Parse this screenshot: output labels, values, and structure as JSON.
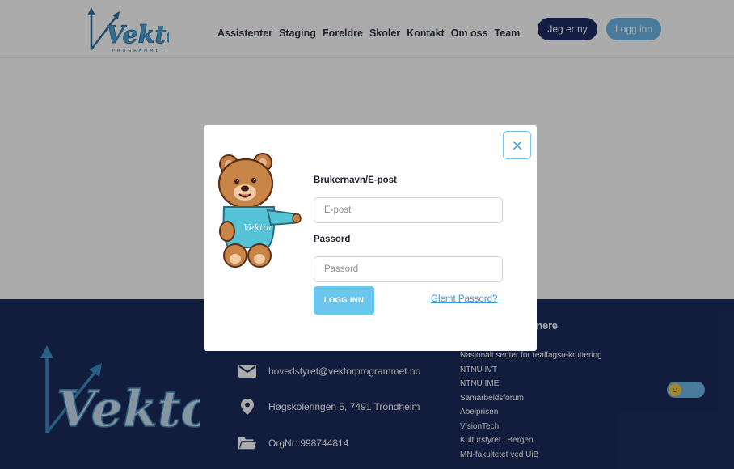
{
  "brand": {
    "name": "Vektor",
    "subtitle": "PROGRAMMET"
  },
  "nav": {
    "items": [
      {
        "label": "Assistenter"
      },
      {
        "label": "Staging"
      },
      {
        "label": "Foreldre"
      },
      {
        "label": "Skoler"
      },
      {
        "label": "Kontakt"
      },
      {
        "label": "Om oss"
      },
      {
        "label": "Team"
      }
    ],
    "new_label": "Jeg er ny",
    "login_label": "Logg inn"
  },
  "modal": {
    "username_label": "Brukernavn/E-post",
    "username_placeholder": "E-post",
    "username_value": "",
    "password_label": "Passord",
    "password_placeholder": "Passord",
    "password_value": "",
    "submit_label": "LOGG INN",
    "forgot_label": "Glemt Passord?",
    "mascot_shirt_text": "Vektor"
  },
  "footer": {
    "email": "hovedstyret@vektorprogrammet.no",
    "address": "Høgskoleringen 5, 7491 Trondheim",
    "orgnr": "OrgNr: 998744814",
    "partners_title": "Samarbeidspartnere",
    "partners": [
      "Nasjonalt senter for realfagsrekruttering",
      "NTNU IVT",
      "NTNU IME",
      "Samarbeidsforum",
      "Abelprisen",
      "VisionTech",
      "Kulturstyret i Bergen",
      "MN-fakultetet ved UiB"
    ]
  },
  "icons": {
    "email": "envelope-icon",
    "address": "map-pin-icon",
    "orgnr": "folder-icon",
    "close": "close-icon",
    "theme": "sun-face-icon"
  },
  "colors": {
    "navy": "#1c2b5b",
    "accent": "#6fb7e8",
    "login_button": "#69c6ee",
    "logo": "#3e8dbf"
  }
}
